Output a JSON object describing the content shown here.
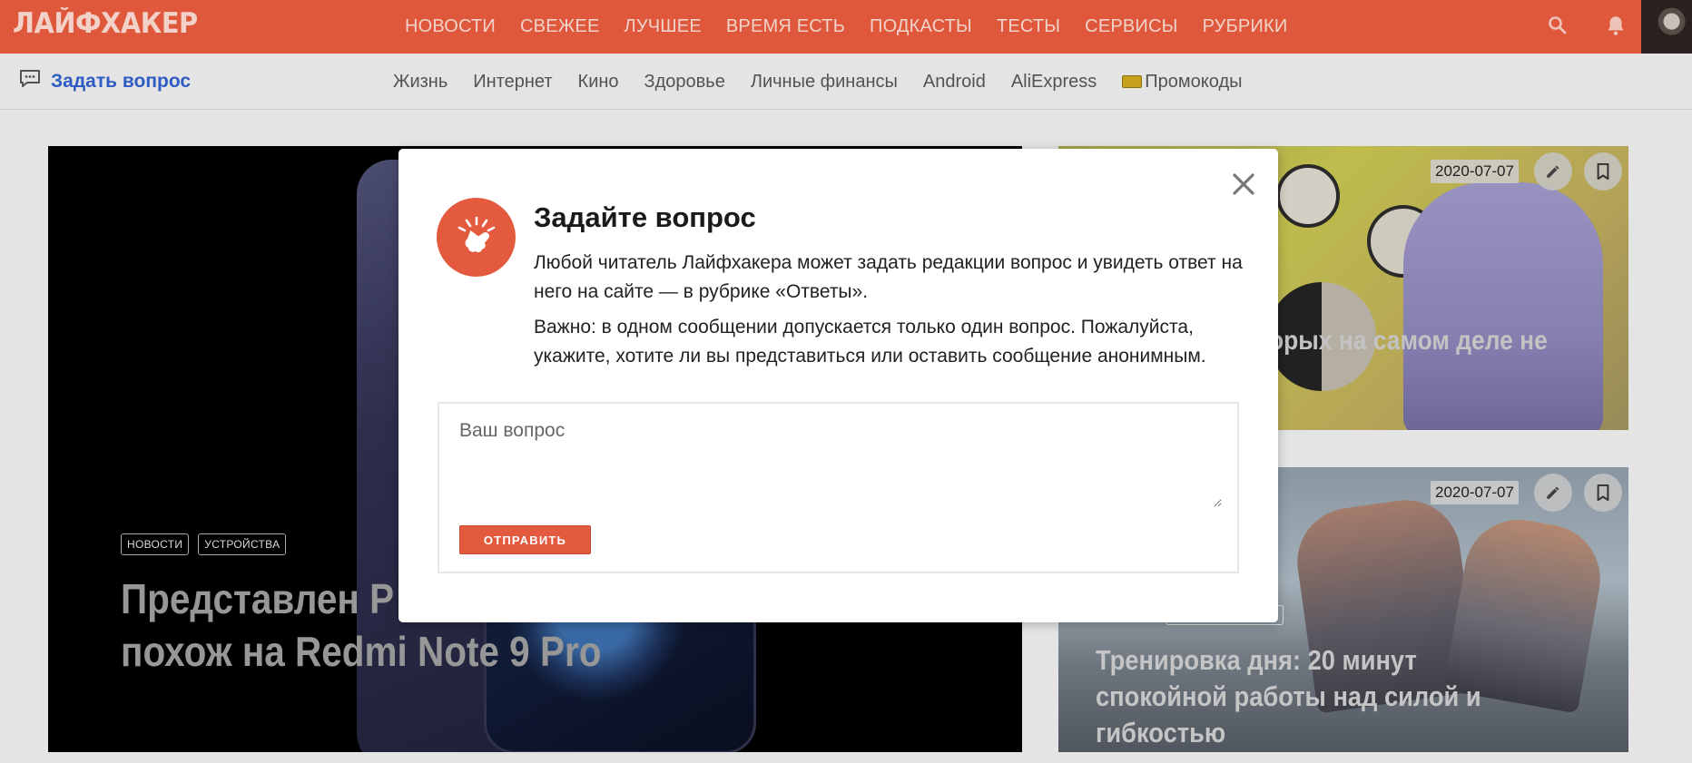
{
  "header": {
    "logo": "ЛАЙФХАКЕР",
    "nav": [
      "НОВОСТИ",
      "СВЕЖЕЕ",
      "ЛУЧШЕЕ",
      "ВРЕМЯ ЕСТЬ",
      "ПОДКАСТЫ",
      "ТЕСТЫ",
      "СЕРВИСЫ",
      "РУБРИКИ"
    ],
    "icons": [
      "search-icon",
      "bell-icon"
    ]
  },
  "subheader": {
    "ask_label": "Задать вопрос",
    "categories": [
      "Жизнь",
      "Интернет",
      "Кино",
      "Здоровье",
      "Личные финансы",
      "Android",
      "AliExpress",
      "Промокоды"
    ]
  },
  "cards": {
    "main": {
      "tags": [
        "НОВОСТИ",
        "УСТРОЙСТВА"
      ],
      "title_visible": "Представлен P",
      "title_line2": "похож на Redmi Note 9 Pro"
    },
    "top": {
      "date": "2020-07-07",
      "title_visible": "орых на самом деле не"
    },
    "bottom": {
      "date": "2020-07-07",
      "title": "Тренировка дня: 20 минут спокойной работы над силой и гибкостью"
    }
  },
  "modal": {
    "title": "Задайте вопрос",
    "paragraph1": "Любой читатель Лайфхакера может задать редакции вопрос и увидеть ответ на него на сайте — в рубрике «Ответы».",
    "paragraph2": "Важно: в одном сообщении допускается только один вопрос. Пожалуйста, укажите, хотите ли вы представиться или оставить сообщение анонимным.",
    "input_placeholder": "Ваш вопрос",
    "input_value": "",
    "submit_label": "ОТПРАВИТЬ"
  },
  "colors": {
    "brand": "#e45a3e",
    "link": "#2f5ec8"
  }
}
